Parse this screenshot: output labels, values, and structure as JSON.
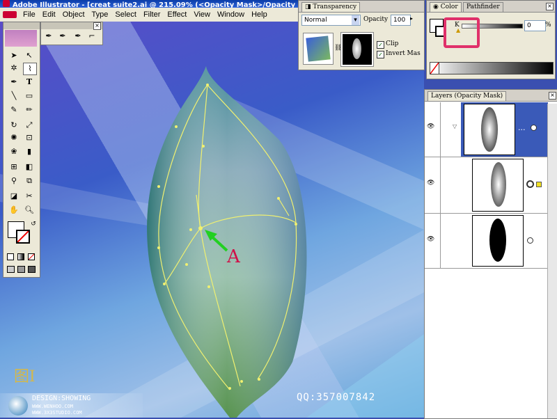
{
  "app": {
    "title": "Adobe Illustrator - [creat suite2.ai @ 215.09% (<Opacity Mask>/Opacity Ma",
    "menu": [
      "File",
      "Edit",
      "Object",
      "Type",
      "Select",
      "Filter",
      "Effect",
      "View",
      "Window",
      "Help"
    ]
  },
  "transparency": {
    "tab": "Transparency",
    "blend_mode": "Normal",
    "opacity_label": "Opacity",
    "opacity_value": "100",
    "clip_label": "Clip",
    "clip_checked": true,
    "invert_label": "Invert Mas",
    "invert_checked": true
  },
  "color": {
    "tabs": [
      "Color",
      "Pathfinder"
    ],
    "channel": "K",
    "value": "0",
    "unit": "%"
  },
  "layers": {
    "tab": "Layers (Opacity Mask)",
    "rows": [
      {
        "selected": true,
        "dots": "..."
      },
      {
        "selected": false
      },
      {
        "selected": false
      }
    ]
  },
  "canvas": {
    "annotation": "A",
    "figure_label": "图I",
    "qq": "QQ:357007842",
    "watermark_line1": "DESIGN:SHOWING",
    "watermark_line2": "WWW.WENHOO.COM",
    "watermark_line3": "WWW.3X3STUDIO.COM"
  },
  "colors": {
    "annotation_arrow": "#22d022",
    "annotation_text": "#d01048",
    "highlight_box": "#e0306a",
    "path": "#f0f070",
    "selected_row": "#3a5ab8"
  }
}
